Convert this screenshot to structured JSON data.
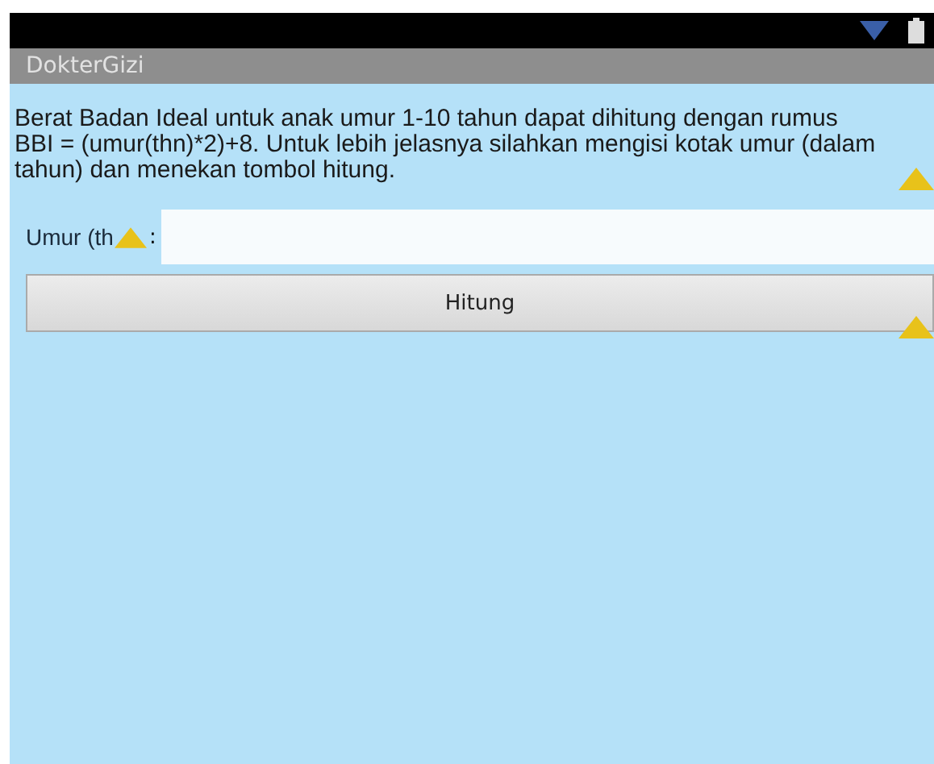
{
  "app_bar": {
    "title": "DokterGizi"
  },
  "description": "Berat Badan Ideal untuk anak umur 1-10 tahun dapat dihitung dengan rumus BBI = (umur(thn)*2)+8. Untuk lebih jelasnya silahkan mengisi kotak umur (dalam tahun) dan menekan tombol hitung.",
  "age_field": {
    "label": "Umur (th",
    "separator": ":"
  },
  "button": {
    "label": "Hitung"
  }
}
